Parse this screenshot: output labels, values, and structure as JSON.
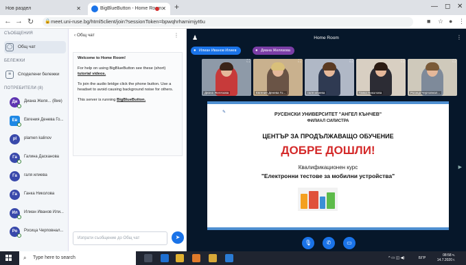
{
  "browser": {
    "tabs": [
      {
        "label": "Нов раздел"
      },
      {
        "label": "BigBlueButton - Home Room"
      }
    ],
    "url": "meet.uni-ruse.bg/html5client/join?sessionToken=bpwqhrhamimjyt6u"
  },
  "sidebar": {
    "messages_title": "СЪОБЩЕНИЯ",
    "public_chat_label": "Общ чат",
    "notes_title": "БЕЛЕЖКИ",
    "shared_notes_label": "Споделени бележки",
    "users_title": "ПОТРЕБИТЕЛИ (8)",
    "users": [
      {
        "initials": "Ди",
        "name": "Диана Желя... (Вие)",
        "color": "#5e35b1"
      },
      {
        "initials": "Ев",
        "name": "Евгения Денева Го...",
        "color": "#1e88e5"
      },
      {
        "initials": "pl",
        "name": "plamen kalinov",
        "color": "#3949ab"
      },
      {
        "initials": "Га",
        "name": "Галина Дасканова",
        "color": "#3949ab"
      },
      {
        "initials": "Га",
        "name": "галя илиева",
        "color": "#3949ab"
      },
      {
        "initials": "Га",
        "name": "Ганка Николова",
        "color": "#3949ab"
      },
      {
        "initials": "Ил",
        "name": "Илиан Иванов Или...",
        "color": "#3949ab"
      },
      {
        "initials": "Ро",
        "name": "Росица Черповнал...",
        "color": "#3949ab"
      }
    ]
  },
  "chat": {
    "header": "Общ чат",
    "welcome_title": "Welcome to Home Room!",
    "help_text_1": "For help on using BigBlueButton see these (short) ",
    "help_link": "tutorial videos.",
    "audio_text": "To join the audio bridge click the phone button. Use a headset to avoid causing background noise for others.",
    "server_text": "This server is running ",
    "server_link": "BigBlueButton.",
    "input_placeholder": "Изпрати съобщение до Общ чат"
  },
  "main": {
    "room_title": "Home Room",
    "talkers": [
      {
        "name": "Илиан Иванов Илиев"
      },
      {
        "name": "Диана Желязова"
      }
    ],
    "videos": [
      {
        "name": "Диана Желязова",
        "wall": "#8e9aa8",
        "top": "#c73a3a",
        "hair": "#3a2418"
      },
      {
        "name": "Евгения Денева Го...",
        "wall": "#c9b18e",
        "top": "#6a5446",
        "hair": "#d9c07a"
      },
      {
        "name": "галя илиева",
        "wall": "#b0b8c6",
        "top": "#2f3a52",
        "hair": "#5a3a22"
      },
      {
        "name": "Ганка Николова",
        "wall": "#d8cfc2",
        "top": "#2c2c34",
        "hair": "#2a1a12"
      },
      {
        "name": "Росица Черповнал...",
        "wall": "#cfc9bb",
        "top": "#7e8a9a",
        "hair": "#7a5a38"
      }
    ],
    "slide": {
      "university": "РУСЕНСКИ УНИВЕРСИТЕТ \"АНГЕЛ КЪНЧЕВ\"",
      "branch": "ФИЛИАЛ СИЛИСТРА",
      "center": "ЦЕНТЪР ЗА ПРОДЪЛЖАВАЩО ОБУЧЕНИЕ",
      "welcome": "ДОБРЕ ДОШЛИ!",
      "qualification": "Квалификационен курс",
      "course": "\"Електронни тестове за мобилни устройства\""
    }
  },
  "taskbar": {
    "search_placeholder": "Type here to search",
    "language": "БГР",
    "time": "08:58 ч.",
    "date": "14.7.2020 г."
  }
}
